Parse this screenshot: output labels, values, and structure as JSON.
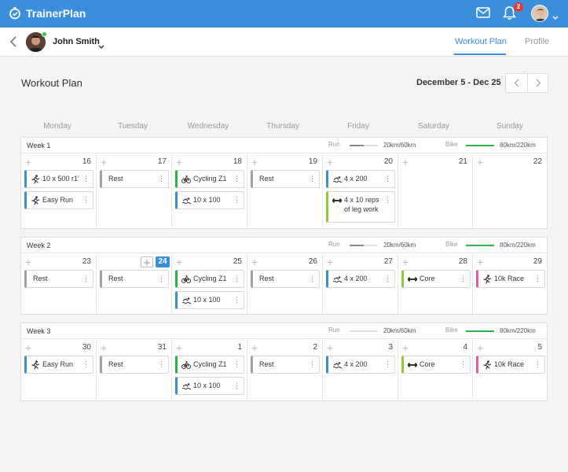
{
  "app": {
    "brand": "TrainerPlan",
    "notification_count": "2"
  },
  "subnav": {
    "user_name": "John Smith",
    "tabs": [
      "Workout Plan",
      "Profile"
    ]
  },
  "page": {
    "title": "Workout Plan",
    "date_range": "December 5 - Dec 25"
  },
  "day_names": [
    "Monday",
    "Tuesday",
    "Wednesday",
    "Thursday",
    "Friday",
    "Saturday",
    "Sunday"
  ],
  "colors": {
    "accent": "#3b8ed9",
    "run": "#3b8ed9",
    "bike": "#2db34a",
    "rest": "#a0a0a0",
    "core": "#8dc63f",
    "race": "#e95aa6"
  },
  "weeks": [
    {
      "label": "Week 1",
      "run_label": "Run",
      "run_value": "20km/60km",
      "run_progress": 0.5,
      "bike_label": "Bike",
      "bike_value": "80km/220km",
      "bike_progress": 1.0,
      "days": [
        {
          "num": "16",
          "cards": [
            {
              "icon": "run",
              "text": "10 x 500 r1'",
              "color": "#3b8ed9"
            },
            {
              "icon": "run",
              "text": "Easy Run",
              "color": "#3b8ed9"
            }
          ]
        },
        {
          "num": "17",
          "cards": [
            {
              "icon": "",
              "text": "Rest",
              "color": "#a0a0a0"
            }
          ]
        },
        {
          "num": "18",
          "cards": [
            {
              "icon": "bike",
              "text": "Cycling Z1",
              "color": "#2db34a"
            },
            {
              "icon": "swim",
              "text": "10 x 100",
              "color": "#3b8ed9"
            }
          ]
        },
        {
          "num": "19",
          "cards": [
            {
              "icon": "",
              "text": "Rest",
              "color": "#a0a0a0"
            }
          ]
        },
        {
          "num": "20",
          "cards": [
            {
              "icon": "swim",
              "text": "4 x 200",
              "color": "#3b8ed9"
            },
            {
              "icon": "weights",
              "text": "4 x 10 reps of leg work",
              "color": "#8dc63f"
            }
          ]
        },
        {
          "num": "21",
          "cards": []
        },
        {
          "num": "22",
          "cards": []
        }
      ]
    },
    {
      "label": "Week 2",
      "run_label": "Run",
      "run_value": "20km/60km",
      "run_progress": 0.5,
      "bike_label": "Bike",
      "bike_value": "80km/220km",
      "bike_progress": 1.0,
      "days": [
        {
          "num": "23",
          "cards": [
            {
              "icon": "",
              "text": "Rest",
              "color": "#a0a0a0"
            }
          ]
        },
        {
          "num": "24",
          "today": true,
          "cards": [
            {
              "icon": "",
              "text": "Rest",
              "color": "#a0a0a0"
            }
          ]
        },
        {
          "num": "25",
          "cards": [
            {
              "icon": "bike",
              "text": "Cycling Z1",
              "color": "#2db34a"
            },
            {
              "icon": "swim",
              "text": "10 x 100",
              "color": "#3b8ed9"
            }
          ]
        },
        {
          "num": "26",
          "cards": [
            {
              "icon": "",
              "text": "Rest",
              "color": "#a0a0a0"
            }
          ]
        },
        {
          "num": "27",
          "cards": [
            {
              "icon": "swim",
              "text": "4 x 200",
              "color": "#3b8ed9"
            }
          ]
        },
        {
          "num": "28",
          "cards": [
            {
              "icon": "weights",
              "text": "Core",
              "color": "#8dc63f"
            }
          ]
        },
        {
          "num": "29",
          "cards": [
            {
              "icon": "run",
              "text": "10k Race",
              "color": "#e95aa6"
            }
          ]
        }
      ]
    },
    {
      "label": "Week 3",
      "run_label": "Run",
      "run_value": "20km/60km",
      "run_progress": 0.0,
      "bike_label": "Bike",
      "bike_value": "80km/220km",
      "bike_progress": 1.0,
      "days": [
        {
          "num": "30",
          "cards": [
            {
              "icon": "run",
              "text": "Easy Run",
              "color": "#3b8ed9"
            }
          ]
        },
        {
          "num": "31",
          "cards": [
            {
              "icon": "",
              "text": "Rest",
              "color": "#a0a0a0"
            }
          ]
        },
        {
          "num": "1",
          "cards": [
            {
              "icon": "bike",
              "text": "Cycling Z1",
              "color": "#2db34a"
            },
            {
              "icon": "swim",
              "text": "10 x 100",
              "color": "#3b8ed9"
            }
          ]
        },
        {
          "num": "2",
          "cards": [
            {
              "icon": "",
              "text": "Rest",
              "color": "#a0a0a0"
            }
          ]
        },
        {
          "num": "3",
          "cards": [
            {
              "icon": "swim",
              "text": "4 x 200",
              "color": "#3b8ed9"
            }
          ]
        },
        {
          "num": "4",
          "cards": [
            {
              "icon": "weights",
              "text": "Core",
              "color": "#8dc63f"
            }
          ]
        },
        {
          "num": "5",
          "cards": [
            {
              "icon": "run",
              "text": "10k Race",
              "color": "#e95aa6"
            }
          ]
        }
      ]
    }
  ]
}
